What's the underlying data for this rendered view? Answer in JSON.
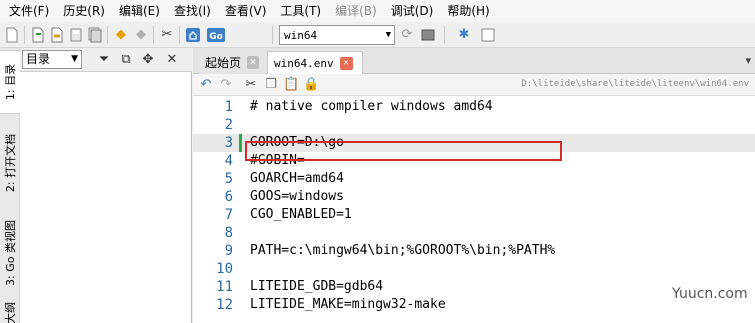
{
  "menu": {
    "items": [
      {
        "label": "文件(F)",
        "disabled": false
      },
      {
        "label": "历史(R)",
        "disabled": false
      },
      {
        "label": "编辑(E)",
        "disabled": false
      },
      {
        "label": "查找(I)",
        "disabled": false
      },
      {
        "label": "查看(V)",
        "disabled": false
      },
      {
        "label": "工具(T)",
        "disabled": false
      },
      {
        "label": "编译(B)",
        "disabled": true
      },
      {
        "label": "调试(D)",
        "disabled": false
      },
      {
        "label": "帮助(H)",
        "disabled": false
      }
    ]
  },
  "toolbar": {
    "env_value": "win64",
    "icons": [
      "new-file-icon",
      "open-file-icon",
      "open-folder-icon",
      "save-icon",
      "save-all-icon",
      "go-back-icon",
      "go-forward-icon",
      "tools-icon",
      "home-icon",
      "go-icon",
      "refresh-icon",
      "terminal-icon",
      "settings-icon",
      "checkbox-icon"
    ],
    "go_label": "Go"
  },
  "side_tabs": {
    "tab1": "1: 目录",
    "tab2": "2: 打开文档",
    "tab3": "3: Go 类视图",
    "tab4": "大纲"
  },
  "left_panel": {
    "select_value": "目录"
  },
  "editor": {
    "tabs": [
      {
        "label": "起始页",
        "active": false
      },
      {
        "label": "win64.env",
        "active": true
      }
    ],
    "file_path": "D:\\liteide\\share\\liteide\\liteenv\\win64.env",
    "lines": [
      {
        "num": "1",
        "text": "# native compiler windows amd64"
      },
      {
        "num": "2",
        "text": ""
      },
      {
        "num": "3",
        "text": "GOROOT=D:\\go"
      },
      {
        "num": "4",
        "text": "#GOBIN="
      },
      {
        "num": "5",
        "text": "GOARCH=amd64"
      },
      {
        "num": "6",
        "text": "GOOS=windows"
      },
      {
        "num": "7",
        "text": "CGO_ENABLED=1"
      },
      {
        "num": "8",
        "text": ""
      },
      {
        "num": "9",
        "text": "PATH=c:\\mingw64\\bin;%GOROOT%\\bin;%PATH%"
      },
      {
        "num": "10",
        "text": ""
      },
      {
        "num": "11",
        "text": "LITEIDE_GDB=gdb64"
      },
      {
        "num": "12",
        "text": "LITEIDE_MAKE=mingw32-make"
      }
    ],
    "current_line": 3,
    "highlight_color": "#d22b2b"
  },
  "watermark": "Yuucn.com"
}
